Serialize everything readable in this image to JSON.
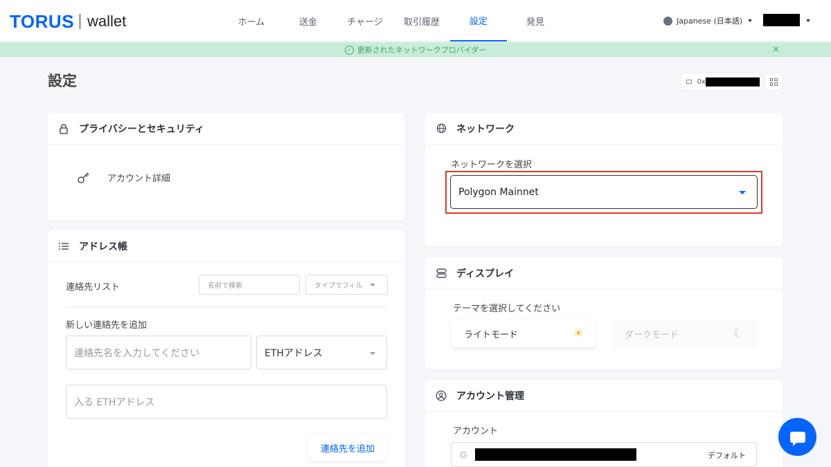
{
  "header": {
    "logo_mark": "TORUS",
    "logo_sub": "wallet",
    "nav": [
      "ホーム",
      "送金",
      "チャージ",
      "取引履歴",
      "設定",
      "発見"
    ],
    "language": "Japanese (日本語)"
  },
  "banner": {
    "text": "更新されたネットワークプロバイダー",
    "close": "×"
  },
  "page": {
    "title": "設定",
    "address_prefix": "0x"
  },
  "privacy": {
    "title": "プライバシーとセキュリティ",
    "account_details": "アカウント詳細"
  },
  "addressbook": {
    "title": "アドレス帳",
    "contacts_label": "連絡先リスト",
    "search_placeholder": "名前で検索",
    "filter_placeholder": "タイプでフィル",
    "add_label": "新しい連絡先を追加",
    "name_placeholder": "連絡先名を入力してください",
    "type_value": "ETHアドレス",
    "address_placeholder": "入る ETHアドレス",
    "add_button": "連絡先を追加"
  },
  "network": {
    "title": "ネットワーク",
    "select_label": "ネットワークを選択",
    "selected": "Polygon Mainnet",
    "highlight_color": "#e8332a"
  },
  "display": {
    "title": "ディスプレイ",
    "theme_label": "テーマを選択してください",
    "light": "ライトモード",
    "dark": "ダークモード"
  },
  "account": {
    "title": "アカウント管理",
    "label": "アカウント",
    "provider_icon": "G",
    "default": "デフォルト"
  },
  "colors": {
    "accent": "#0364ff",
    "banner_bg": "#c9ecd8",
    "banner_text": "#3aa56b"
  }
}
